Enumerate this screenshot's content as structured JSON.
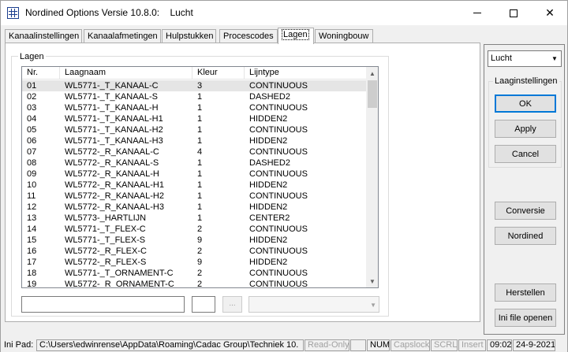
{
  "window": {
    "title": "Nordined Options Versie 10.8.0:    Lucht",
    "minimize_glyph": "",
    "maximize_glyph": "",
    "close_glyph": "✕"
  },
  "tabs": [
    {
      "label": "Kanaalinstellingen",
      "active": false
    },
    {
      "label": "Kanaalafmetingen",
      "active": false
    },
    {
      "label": "Hulpstukken",
      "active": false
    },
    {
      "label": "Procescodes",
      "active": false
    },
    {
      "label": "Lagen",
      "active": true
    },
    {
      "label": "Woningbouw",
      "active": false
    }
  ],
  "layers_group": {
    "label": "Lagen",
    "columns": {
      "nr": "Nr.",
      "naam": "Laagnaam",
      "kleur": "Kleur",
      "lijntype": "Lijntype"
    },
    "rows": [
      {
        "nr": "01",
        "naam": "WL5771-_T_KANAAL-C",
        "kleur": "3",
        "lijntype": "CONTINUOUS",
        "selected": true
      },
      {
        "nr": "02",
        "naam": "WL5771-_T_KANAAL-S",
        "kleur": "1",
        "lijntype": "DASHED2"
      },
      {
        "nr": "03",
        "naam": "WL5771-_T_KANAAL-H",
        "kleur": "1",
        "lijntype": "CONTINUOUS"
      },
      {
        "nr": "04",
        "naam": "WL5771-_T_KANAAL-H1",
        "kleur": "1",
        "lijntype": "HIDDEN2"
      },
      {
        "nr": "05",
        "naam": "WL5771-_T_KANAAL-H2",
        "kleur": "1",
        "lijntype": "CONTINUOUS"
      },
      {
        "nr": "06",
        "naam": "WL5771-_T_KANAAL-H3",
        "kleur": "1",
        "lijntype": "HIDDEN2"
      },
      {
        "nr": "07",
        "naam": "WL5772-_R_KANAAL-C",
        "kleur": "4",
        "lijntype": "CONTINUOUS"
      },
      {
        "nr": "08",
        "naam": "WL5772-_R_KANAAL-S",
        "kleur": "1",
        "lijntype": "DASHED2"
      },
      {
        "nr": "09",
        "naam": "WL5772-_R_KANAAL-H",
        "kleur": "1",
        "lijntype": "CONTINUOUS"
      },
      {
        "nr": "10",
        "naam": "WL5772-_R_KANAAL-H1",
        "kleur": "1",
        "lijntype": "HIDDEN2"
      },
      {
        "nr": "11",
        "naam": "WL5772-_R_KANAAL-H2",
        "kleur": "1",
        "lijntype": "CONTINUOUS"
      },
      {
        "nr": "12",
        "naam": "WL5772-_R_KANAAL-H3",
        "kleur": "1",
        "lijntype": "HIDDEN2"
      },
      {
        "nr": "13",
        "naam": "WL5773-_HARTLIJN",
        "kleur": "1",
        "lijntype": "CENTER2"
      },
      {
        "nr": "14",
        "naam": "WL5771-_T_FLEX-C",
        "kleur": "2",
        "lijntype": "CONTINUOUS"
      },
      {
        "nr": "15",
        "naam": "WL5771-_T_FLEX-S",
        "kleur": "9",
        "lijntype": "HIDDEN2"
      },
      {
        "nr": "16",
        "naam": "WL5772-_R_FLEX-C",
        "kleur": "2",
        "lijntype": "CONTINUOUS"
      },
      {
        "nr": "17",
        "naam": "WL5772-_R_FLEX-S",
        "kleur": "9",
        "lijntype": "HIDDEN2"
      },
      {
        "nr": "18",
        "naam": "WL5771-_T_ORNAMENT-C",
        "kleur": "2",
        "lijntype": "CONTINUOUS"
      },
      {
        "nr": "19",
        "naam": "WL5772-_R_ORNAMENT-C",
        "kleur": "2",
        "lijntype": "CONTINUOUS"
      }
    ],
    "edit_name_value": "",
    "edit_color_value": "",
    "browse_button_label": "...",
    "linetype_combo_value": ""
  },
  "right_panel": {
    "medium_combo_value": "Lucht",
    "group_label": "Laaginstellingen",
    "ok_label": "OK",
    "apply_label": "Apply",
    "cancel_label": "Cancel",
    "conversie_label": "Conversie",
    "nordined_label": "Nordined",
    "herstellen_label": "Herstellen",
    "ini_open_label": "Ini file openen"
  },
  "statusbar": {
    "ini_pad_label": "Ini Pad:",
    "ini_path": "C:\\Users\\edwinrense\\AppData\\Roaming\\Cadac Group\\Techniek 10.",
    "read_only": "Read-Only",
    "num": "NUM",
    "capslock": "Capslock",
    "scrl": "SCRL",
    "insert": "Insert",
    "time": "09:02",
    "date": "24-9-2021"
  },
  "colors": {
    "selected_row": "#e5e5e5",
    "default_button_border": "#0078d7"
  }
}
